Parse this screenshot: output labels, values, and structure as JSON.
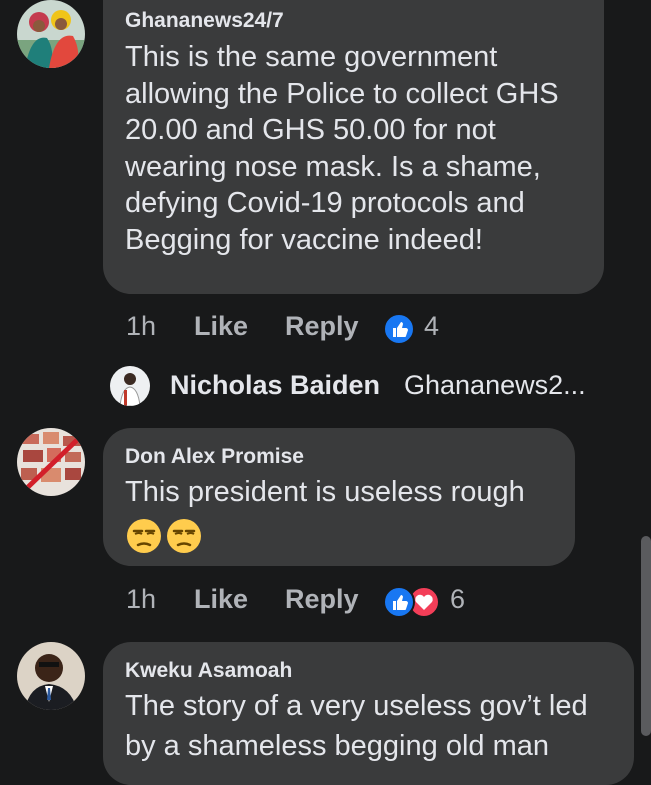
{
  "comments": [
    {
      "author": "Ghananews24/7",
      "lines": [
        "This is the same government",
        "allowing the Police to collect GHS",
        "20.00 and GHS 50.00 for not",
        "wearing nose mask. Is a shame,",
        "defying Covid-19 protocols and",
        "Begging for vaccine indeed!"
      ],
      "time": "1h",
      "like_label": "Like",
      "reply_label": "Reply",
      "reaction_count": "4",
      "reactions": [
        "like-icon"
      ]
    },
    {
      "author": "Don Alex Promise",
      "lines": [
        "This president is useless rough"
      ],
      "emojis": [
        "unamused-face",
        "unamused-face"
      ],
      "time": "1h",
      "like_label": "Like",
      "reply_label": "Reply",
      "reaction_count": "6",
      "reactions": [
        "like-icon",
        "heart-icon"
      ]
    },
    {
      "author": "Kweku Asamoah",
      "lines": [
        "The story of a very useless gov’t led",
        "by a shameless begging old man"
      ]
    }
  ],
  "reply_preview": {
    "name": "Nicholas Baiden",
    "text": "Ghananews2..."
  },
  "colors": {
    "background": "#18191a",
    "bubble": "#3a3b3c",
    "text": "#e4e6eb",
    "muted": "#b0b3b8",
    "like_blue": "#1877f2",
    "love_red": "#f33e58"
  }
}
